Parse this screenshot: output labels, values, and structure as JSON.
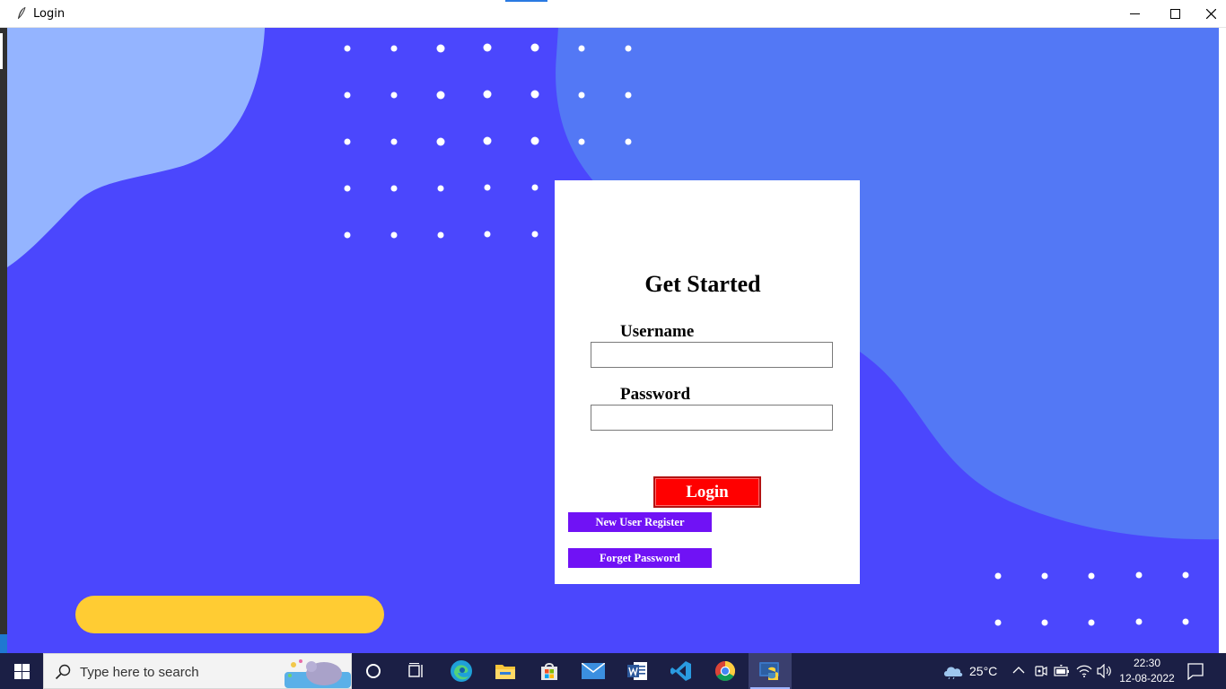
{
  "window": {
    "title": "Login"
  },
  "card": {
    "title": "Get Started",
    "username_label": "Username",
    "password_label": "Password",
    "username_value": "",
    "password_value": "",
    "login_label": "Login",
    "register_label": "New User Register",
    "forget_label": "Forget Password"
  },
  "taskbar": {
    "search_placeholder": "Type here to search",
    "apps": [
      "cortana-icon",
      "task-view-icon",
      "edge-icon",
      "file-explorer-icon",
      "microsoft-store-icon",
      "mail-icon",
      "word-icon",
      "vscode-icon",
      "chrome-icon",
      "python-icon"
    ],
    "weather": "25°C",
    "time": "22:30",
    "date": "12-08-2022"
  },
  "colors": {
    "background": "#4b47fd",
    "left_blob": "#94b4ff",
    "right_blob": "#5378f5",
    "pill": "#ffcc33",
    "login_button": "#ff0000",
    "secondary_button": "#7012f5",
    "taskbar": "#1b1f45"
  }
}
